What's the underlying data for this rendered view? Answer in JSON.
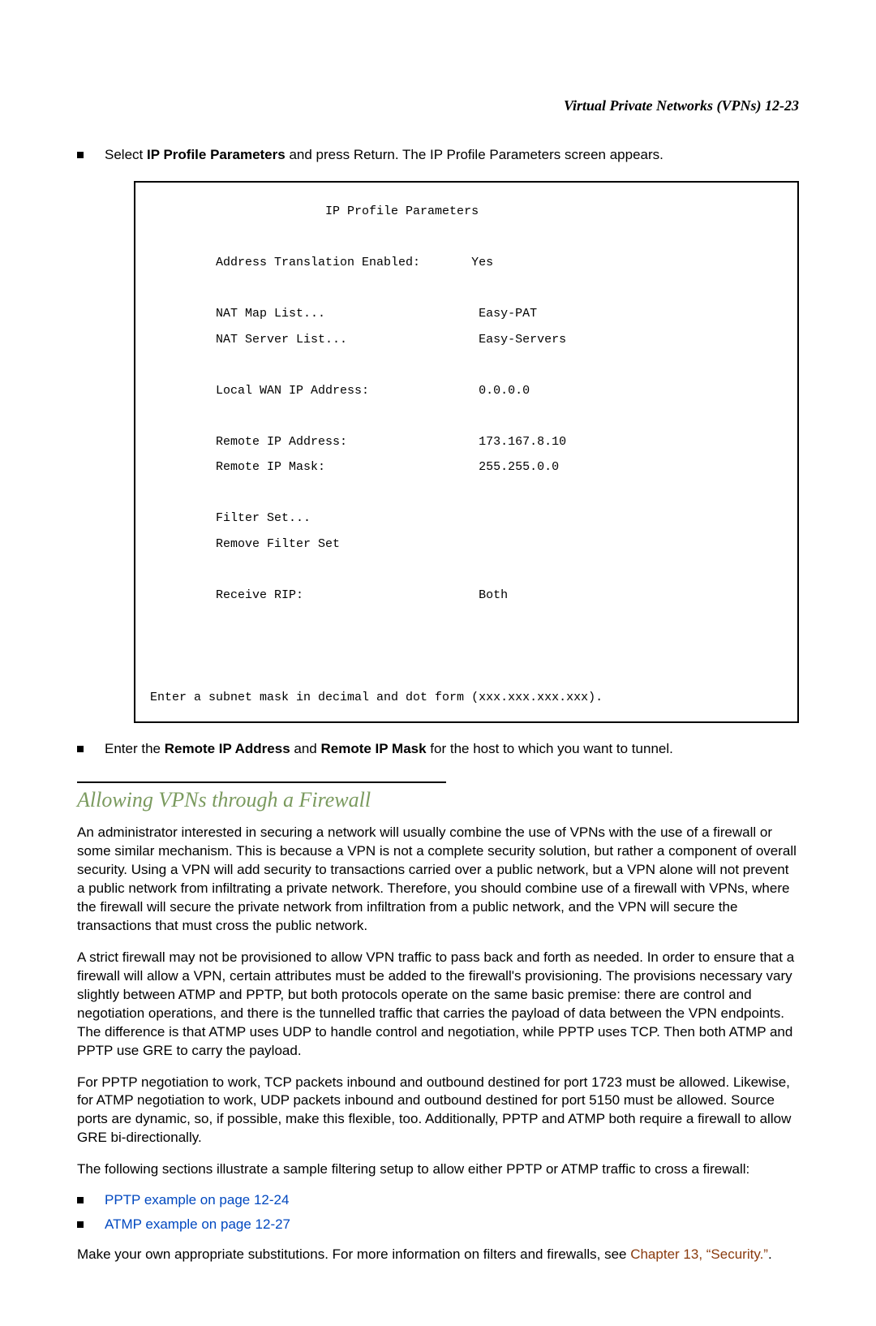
{
  "running_head": "Virtual Private Networks (VPNs)   12-23",
  "step1": {
    "pre": "Select ",
    "bold": "IP Profile Parameters",
    "post": " and press Return. The IP Profile Parameters screen appears."
  },
  "terminal": {
    "title": "                        IP Profile Parameters",
    "l1": "         Address Translation Enabled:       Yes",
    "l2": "         NAT Map List...                     Easy-PAT",
    "l3": "         NAT Server List...                  Easy-Servers",
    "l4": "         Local WAN IP Address:               0.0.0.0",
    "l5": "         Remote IP Address:                  173.167.8.10",
    "l6": "         Remote IP Mask:                     255.255.0.0",
    "l7": "         Filter Set...",
    "l8": "         Remove Filter Set",
    "l9": "         Receive RIP:                        Both",
    "hint": "Enter a subnet mask in decimal and dot form (xxx.xxx.xxx.xxx)."
  },
  "step2": {
    "pre": "Enter the ",
    "b1": "Remote IP Address",
    "mid": " and ",
    "b2": "Remote IP Mask",
    "post": " for the host to which you want to tunnel."
  },
  "heading": "Allowing VPNs through a Firewall",
  "para1": "An administrator interested in securing a network will usually combine the use of VPNs with the use of a firewall or some similar mechanism. This is because a VPN is not a complete security solution, but rather a component of overall security. Using a VPN will add security to transactions carried over a public network, but a VPN alone will not prevent a public network from infiltrating a private network. Therefore, you should combine use of a firewall with VPNs, where the firewall will secure the private network from infiltration from a public network, and the VPN will secure the transactions that must cross the public network.",
  "para2": "A strict firewall may not be provisioned to allow VPN traffic to pass back and forth as needed. In order to ensure that a firewall will allow a VPN, certain attributes must be added to the firewall's provisioning. The provisions necessary vary slightly between ATMP and PPTP, but both protocols operate on the same basic premise: there are control and negotiation operations, and there is the tunnelled traffic that carries the payload of data between the VPN endpoints. The difference is that ATMP uses UDP to handle control and negotiation, while PPTP uses TCP. Then both ATMP and PPTP use GRE to carry the payload.",
  "para3": "For PPTP negotiation to work, TCP packets inbound and outbound destined for port 1723 must be allowed. Likewise, for ATMP negotiation to work, UDP packets inbound and outbound destined for port 5150 must be allowed. Source ports are dynamic, so, if possible, make this flexible, too. Additionally, PPTP and ATMP both require a firewall to allow GRE bi-directionally.",
  "para4": "The following sections illustrate a sample filtering setup to allow either PPTP or ATMP traffic to cross a firewall:",
  "link_pptp": "PPTP example on page 12-24",
  "link_atmp": "ATMP example on page 12-27",
  "closing": {
    "pre": "Make your own appropriate substitutions. For more information on filters and firewalls, see ",
    "link": "Chapter 13, “Security.”",
    "post": "."
  }
}
